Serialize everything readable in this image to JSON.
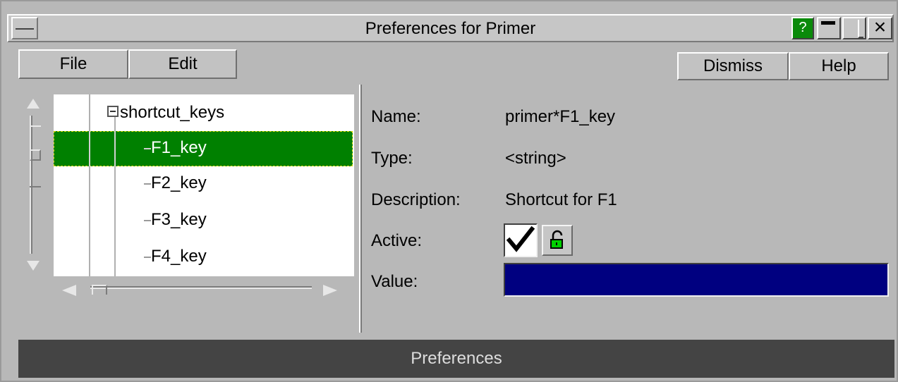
{
  "window": {
    "title": "Preferences for Primer"
  },
  "titlebar": {
    "help_label": "?"
  },
  "menu": {
    "file_label": "File",
    "edit_label": "Edit"
  },
  "actions": {
    "dismiss_label": "Dismiss",
    "help_label": "Help"
  },
  "tree": {
    "root": "shortcut_keys",
    "items": [
      {
        "label": "F1_key",
        "selected": true
      },
      {
        "label": "F2_key",
        "selected": false
      },
      {
        "label": "F3_key",
        "selected": false
      },
      {
        "label": "F4_key",
        "selected": false
      }
    ]
  },
  "properties": {
    "name_label": "Name:",
    "name_value": "primer*F1_key",
    "type_label": "Type:",
    "type_value": "<string>",
    "description_label": "Description:",
    "description_value": "Shortcut for F1",
    "active_label": "Active:",
    "active_checked": true,
    "value_label": "Value:",
    "value_text": ""
  },
  "status": {
    "text": "Preferences"
  },
  "colors": {
    "selection": "#008000",
    "value_field": "#000080",
    "help_icon_bg": "#0a8a0a",
    "statusbar_bg": "#444444"
  }
}
